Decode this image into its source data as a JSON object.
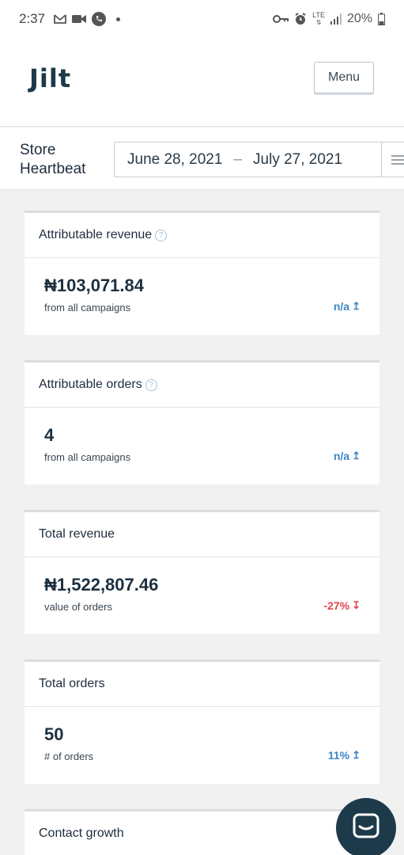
{
  "status_bar": {
    "time": "2:37",
    "battery": "20%",
    "network": "LTE"
  },
  "header": {
    "logo": "Jilt",
    "menu_label": "Menu"
  },
  "subheader": {
    "title_line1": "Store",
    "title_line2": "Heartbeat",
    "date_start": "June 28, 2021",
    "date_sep": "–",
    "date_end": "July 27, 2021"
  },
  "cards": [
    {
      "title": "Attributable revenue",
      "value": "₦103,071.84",
      "subtitle": "from all campaigns",
      "trend": "n/a",
      "trend_dir": "up"
    },
    {
      "title": "Attributable orders",
      "value": "4",
      "subtitle": "from all campaigns",
      "trend": "n/a",
      "trend_dir": "up"
    },
    {
      "title": "Total revenue",
      "value": "₦1,522,807.46",
      "subtitle": "value of orders",
      "trend": "-27%",
      "trend_dir": "down"
    },
    {
      "title": "Total orders",
      "value": "50",
      "subtitle": "# of orders",
      "trend": "11%",
      "trend_dir": "up"
    },
    {
      "title": "Contact growth"
    }
  ],
  "colors": {
    "brand": "#1d3a4a",
    "positive": "#3d86c6",
    "negative": "#e0454f"
  },
  "icons": {
    "help": "question-circle-icon",
    "chat": "chat-bubble-icon"
  }
}
